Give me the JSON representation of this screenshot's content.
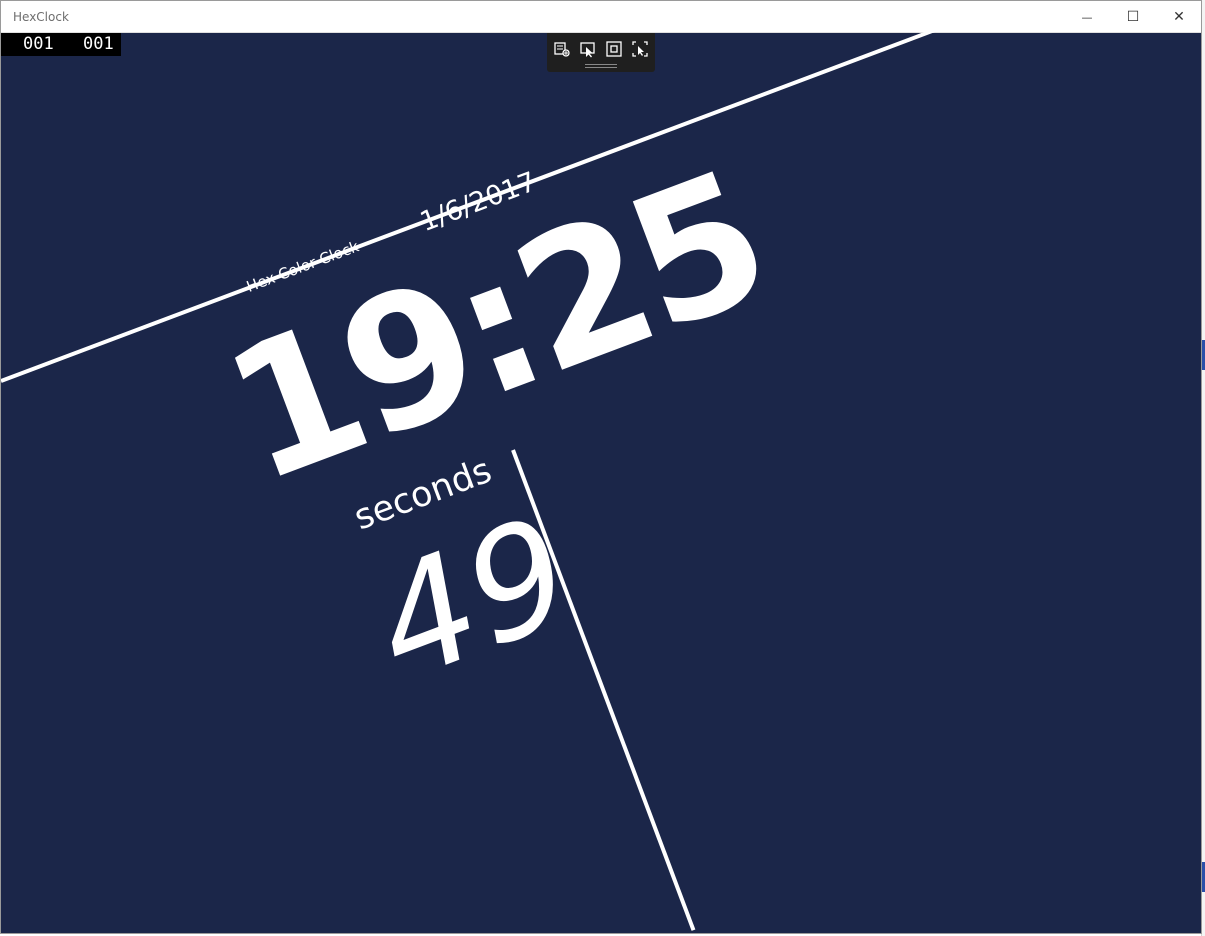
{
  "window": {
    "title": "HexClock"
  },
  "controls": {
    "minimize": "—",
    "maximize": "☐",
    "close": "✕"
  },
  "counters": {
    "left": "001",
    "right": "001"
  },
  "toolbar": {
    "icons": [
      "live-visual-tree-icon",
      "select-element-icon",
      "display-layout-adorners-icon",
      "track-focus-icon"
    ]
  },
  "clock": {
    "caption": "Hex Color Clock",
    "date": "1/6/2017",
    "time": "19:25",
    "seconds_label": "seconds",
    "seconds": "49",
    "background_color": "#1b2649",
    "foreground_color": "#ffffff"
  }
}
